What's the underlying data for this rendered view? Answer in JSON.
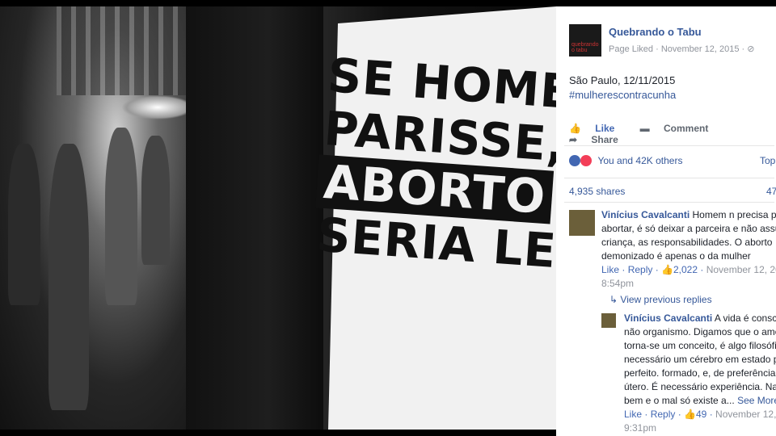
{
  "post": {
    "page_name": "Quebrando o Tabu",
    "avatar_text": "quebrando o tabu",
    "meta": "Page Liked · November 12, 2015 · ⊘",
    "text_line1": "São Paulo, 12/11/2015",
    "hashtag": "#mulherescontracunha"
  },
  "poster": {
    "line1": "SE HOMEM",
    "line2": "PARISSE,",
    "line3": "ABORTO",
    "line4": "SERIA LEGAL"
  },
  "actions": {
    "like": "Like",
    "comment": "Comment",
    "share": "Share"
  },
  "reactions": {
    "summary": "You and 42K others",
    "sort": "Top",
    "shares": "4,935 shares",
    "comment_count": "47"
  },
  "comments": [
    {
      "author": "Vinícius Cavalcanti",
      "text": " Homem n precisa pa abortar, é só deixar a parceira e não assu criança, as responsabilidades. O aborto demonizado é apenas o da mulher",
      "like": "Like",
      "reply": "Reply",
      "likes": "2,022",
      "date": "November 12, 20",
      "time": "8:54pm"
    },
    {
      "author": "Vinícius Cavalcanti",
      "text": " A vida é consc não organismo. Digamos que o amo torna-se um conceito, é algo filosófic necessário um cérebro em estado p perfeito. formado, e, de preferência, útero. É necessário experiência. Na bem e o mal só existe a...",
      "see_more": "See More",
      "like": "Like",
      "reply": "Reply",
      "likes": "49",
      "date": "November 12,",
      "time": "9:31pm"
    }
  ],
  "view_previous": "View previous replies"
}
